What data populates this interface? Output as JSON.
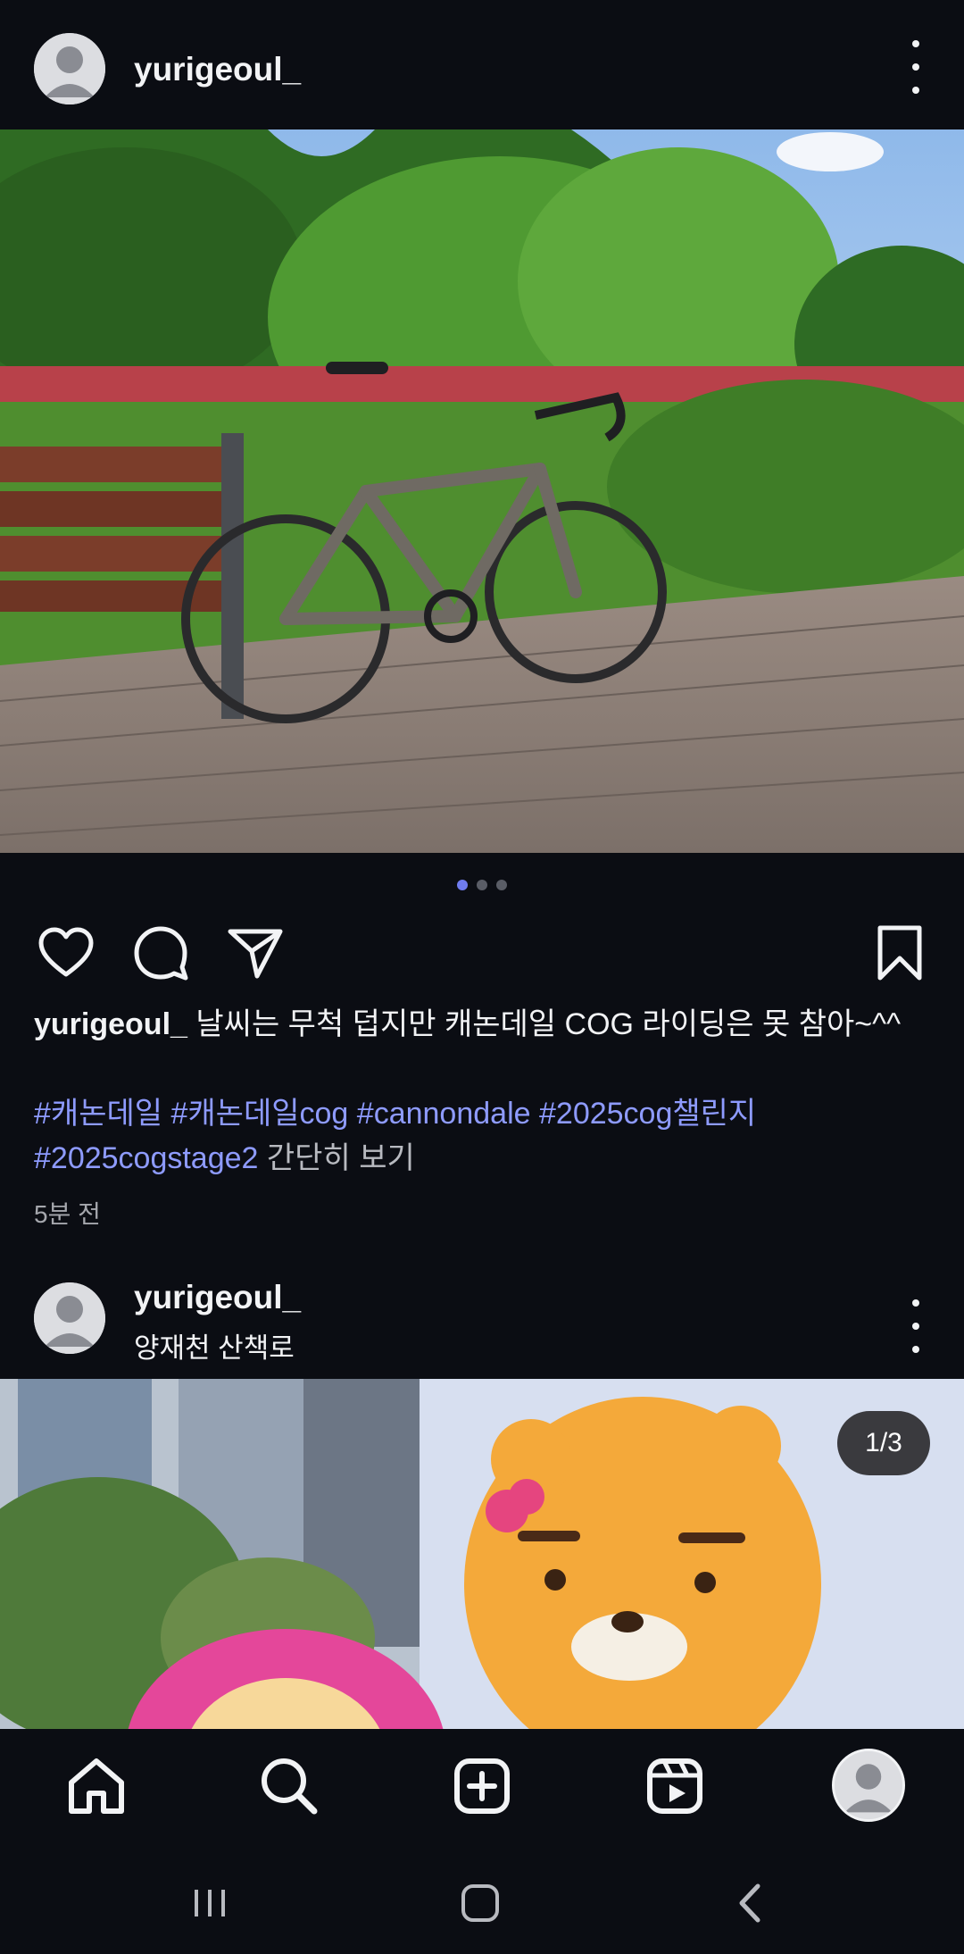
{
  "posts": [
    {
      "username": "yurigeoul_",
      "location": "",
      "caption": "날씨는 무척 덥지만 캐논데일 COG 라이딩은 못 참아~^^",
      "hashtags": [
        "#캐논데일",
        "#캐논데일cog",
        "#cannondale",
        "#2025cog챌린지",
        "#2025cogstage2"
      ],
      "show_less": "간단히 보기",
      "time_ago": "5분 전",
      "carousel": {
        "current": 1,
        "total": 3
      }
    },
    {
      "username": "yurigeoul_",
      "location": "양재천 산책로",
      "counter": "1/3"
    }
  ],
  "icons": {
    "like": "heart-icon",
    "comment": "comment-icon",
    "share": "send-icon",
    "save": "bookmark-icon",
    "more": "more-vertical-icon"
  },
  "nav": [
    "home-icon",
    "search-icon",
    "create-icon",
    "reels-icon",
    "profile-avatar"
  ],
  "system_nav": [
    "recents-button",
    "home-button",
    "back-button"
  ],
  "colors": {
    "background": "#0b0d13",
    "hashtag": "#8e9bff",
    "active_dot": "#6f7cf0"
  }
}
